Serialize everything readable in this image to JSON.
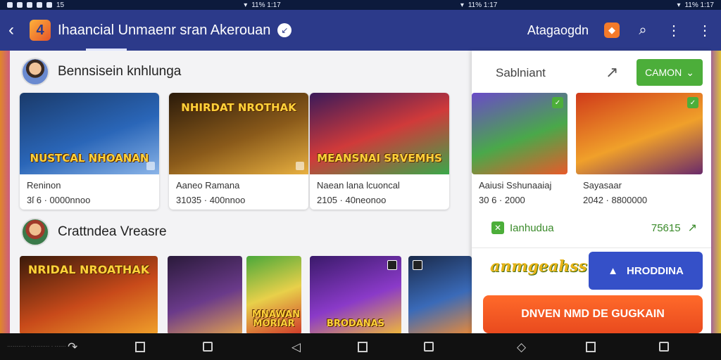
{
  "status_bar": {
    "left": "15",
    "center_left": "11% 1:17",
    "center_right": "11% 1:17",
    "right": "11% 1:17"
  },
  "app_bar": {
    "title": "Ihaancial Unmaenr sran Akerouan",
    "account_name": "Atagaogdn",
    "colors": {
      "background": "#2c3a8a",
      "accent": "#f47a2a"
    }
  },
  "main": {
    "section1": {
      "title": "Bennsisein knhlunga",
      "cards": [
        {
          "title": "Reninon",
          "sub": "3ſ 6 · 0000nnoo",
          "caption": "NUSTCAL NHOANAN",
          "colors": [
            "#1a3a6a",
            "#2a66b8",
            "#8ab4e8"
          ]
        },
        {
          "title": "Aaneo Ramana",
          "sub": "31035 · 400nnoo",
          "caption": "NHIRDAT NROTHAK",
          "colors": [
            "#2a1a0a",
            "#8a5a1a",
            "#e8b040"
          ]
        },
        {
          "title": "Naean lana lcuoncal",
          "sub": "2105 · 40neonoo",
          "caption": "MEANSNAI SRVEMHS",
          "colors": [
            "#3a1a5a",
            "#d03a3a",
            "#3aa84a"
          ]
        }
      ]
    },
    "section2": {
      "title": "Crattndea Vreasre",
      "tiles": [
        {
          "caption": "NRIDAL NROATHAK",
          "colors": [
            "#3a1a0a",
            "#c84a1a",
            "#f0a02a"
          ]
        },
        {
          "caption": "",
          "colors": [
            "#2a1a3a",
            "#6a3a8a",
            "#e0a050"
          ]
        },
        {
          "caption": "MNAWAN MORIAR",
          "colors": [
            "#4aa83a",
            "#e8d04a",
            "#d03a2a"
          ]
        },
        {
          "caption": "BRODANAS",
          "colors": [
            "#3a1a6a",
            "#8a3ac8",
            "#f0b83a"
          ]
        },
        {
          "caption": "",
          "colors": [
            "#1a2a4a",
            "#3a6ab8",
            "#e88a3a"
          ]
        }
      ]
    }
  },
  "panel": {
    "heading": "Sablniant",
    "open_label": "CAMON",
    "mini_cards": [
      {
        "title": "Aaiusi Sshunaaiaj",
        "sub": "30 6 · 2000",
        "colors": [
          "#6a4ac8",
          "#4aa84a",
          "#e85a2a"
        ]
      },
      {
        "title": "Sayasaar",
        "sub": "2042 · 8800000",
        "colors": [
          "#d03a1a",
          "#f0a02a",
          "#6a2a6a"
        ]
      }
    ],
    "stat_label": "Ianhudua",
    "stat_value": "75615",
    "brand_logo": "anmgeahss",
    "install_label": "HRODDINA",
    "download_label": "DNVEN NMD DE GUGKAIN",
    "colors": {
      "green": "#4cae3a",
      "blue": "#3550c8",
      "orange": "#e94a1e"
    }
  },
  "nav_bar": {
    "left_label": "·········· · ·········· · ······"
  }
}
